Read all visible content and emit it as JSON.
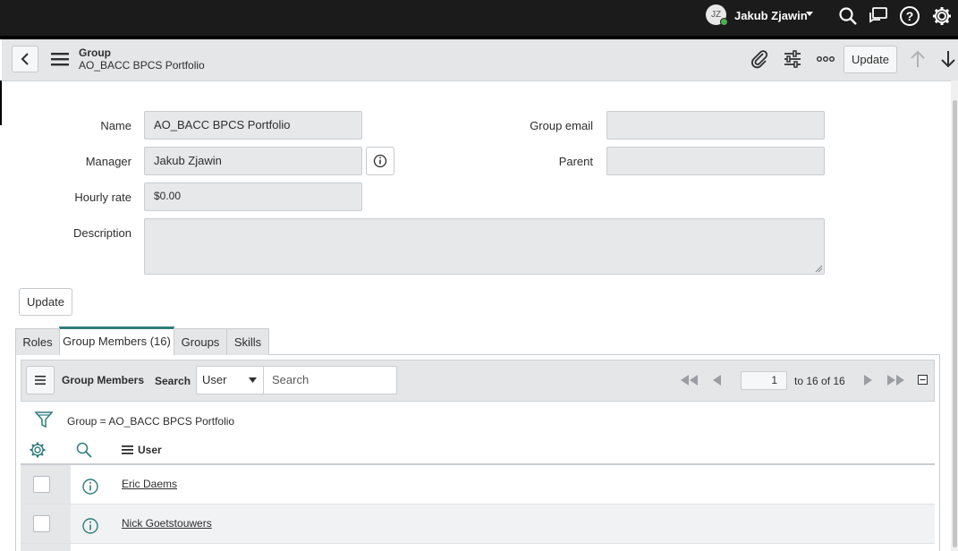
{
  "topnav": {
    "avatar_initials": "JZ",
    "user_name": "Jakub Zjawin",
    "icons": [
      "search-icon",
      "chat-icon",
      "help-icon",
      "gear-icon"
    ]
  },
  "header": {
    "record_type": "Group",
    "record_name": "AO_BACC BPCS Portfolio",
    "update_label": "Update",
    "icons": [
      "back-icon",
      "menu-icon",
      "paperclip-icon",
      "sliders-icon",
      "more-icon",
      "arrow-up-icon",
      "arrow-down-icon"
    ]
  },
  "form": {
    "name_label": "Name",
    "name_value": "AO_BACC BPCS Portfolio",
    "manager_label": "Manager",
    "manager_value": "Jakub Zjawin",
    "hourly_rate_label": "Hourly rate",
    "hourly_rate_value": "$0.00",
    "description_label": "Description",
    "description_value": "",
    "group_email_label": "Group email",
    "group_email_value": "",
    "parent_label": "Parent",
    "parent_value": "",
    "update_label": "Update"
  },
  "tabs": [
    {
      "label": "Roles",
      "active": false
    },
    {
      "label": "Group Members (16)",
      "active": true
    },
    {
      "label": "Groups",
      "active": false
    },
    {
      "label": "Skills",
      "active": false
    }
  ],
  "list": {
    "title": "Group Members",
    "search_label": "Search",
    "search_field": "User",
    "search_placeholder": "Search",
    "page_number": "1",
    "page_range": "to 16 of 16",
    "filter_text": "Group = AO_BACC BPCS Portfolio",
    "column_user": "User",
    "rows": [
      {
        "user": "Eric Daems"
      },
      {
        "user": "Nick Goetstouwers"
      }
    ]
  },
  "colors": {
    "topnav_bg": "#1b1b1b",
    "header_bg": "#e4e6e8",
    "active_tab_accent": "#2f7d79",
    "icon_teal": "#2f7d79"
  }
}
